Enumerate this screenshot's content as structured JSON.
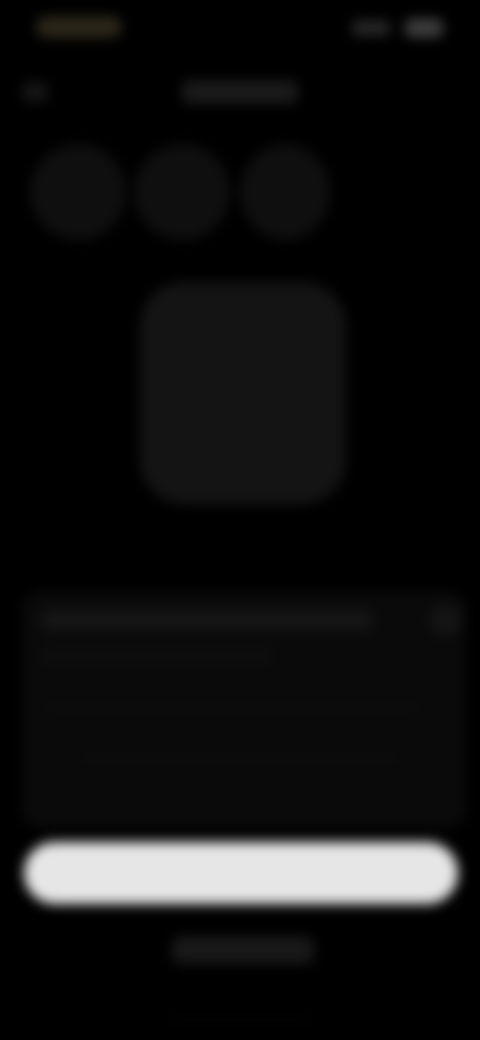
{
  "screen": {
    "background_color": "#000000",
    "blurred": true,
    "note_text_legible": false
  },
  "status_bar": {
    "time_placeholder_color": "#2a2619",
    "battery_icon": "battery-icon",
    "signal_icon": "signal-icon"
  },
  "header": {
    "back_icon": "chevron-left-icon"
  },
  "top_items": [
    {
      "icon": "circle-placeholder"
    },
    {
      "icon": "circle-placeholder"
    },
    {
      "icon": "circle-placeholder"
    }
  ],
  "center_card": {
    "color": "#141414"
  },
  "info_panel": {
    "icon": "info-icon"
  },
  "primary_button": {
    "label": "",
    "color": "#e6e6e6"
  },
  "secondary_link": {
    "label": ""
  }
}
